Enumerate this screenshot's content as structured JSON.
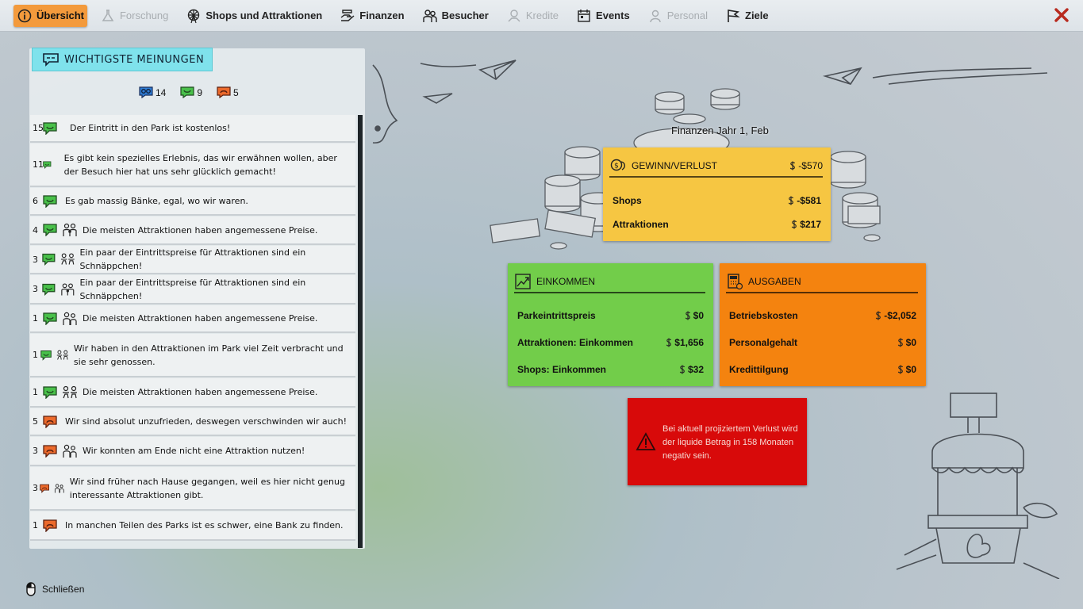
{
  "nav": {
    "tabs": [
      {
        "label": "Übersicht",
        "icon": "info-icon",
        "state": "active"
      },
      {
        "label": "Forschung",
        "icon": "flask-icon",
        "state": "disabled"
      },
      {
        "label": "Shops und Attraktionen",
        "icon": "ferris-wheel-icon",
        "state": "normal"
      },
      {
        "label": "Finanzen",
        "icon": "money-hand-icon",
        "state": "normal"
      },
      {
        "label": "Besucher",
        "icon": "visitors-icon",
        "state": "normal"
      },
      {
        "label": "Kredite",
        "icon": "loan-icon",
        "state": "disabled"
      },
      {
        "label": "Events",
        "icon": "calendar-icon",
        "state": "normal"
      },
      {
        "label": "Personal",
        "icon": "staff-icon",
        "state": "disabled"
      },
      {
        "label": "Ziele",
        "icon": "flag-icon",
        "state": "normal"
      }
    ]
  },
  "opinions": {
    "title": "WICHTIGSTE MEINUNGEN",
    "counts": {
      "neutral": "14",
      "positive": "9",
      "negative": "5"
    },
    "rows": [
      {
        "count": "15",
        "sentiment": "positive",
        "group": "",
        "text": "Der Eintritt in den Park ist kostenlos!"
      },
      {
        "count": "11",
        "sentiment": "positive",
        "group": "",
        "text": "Es gibt kein spezielles Erlebnis, das wir erwähnen wollen, aber der Besuch hier hat uns sehr glücklich gemacht!"
      },
      {
        "count": "6",
        "sentiment": "positive",
        "group": "",
        "text": "Es gab massig Bänke, egal, wo wir waren."
      },
      {
        "count": "4",
        "sentiment": "positive",
        "group": "family",
        "text": "Die meisten Attraktionen haben angemessene Preise."
      },
      {
        "count": "3",
        "sentiment": "positive",
        "group": "teens",
        "text": "Ein paar der Eintrittspreise für Attraktionen sind ein Schnäppchen!"
      },
      {
        "count": "3",
        "sentiment": "positive",
        "group": "family",
        "text": "Ein paar der Eintrittspreise für Attraktionen sind ein Schnäppchen!"
      },
      {
        "count": "1",
        "sentiment": "positive",
        "group": "adults",
        "text": "Die meisten Attraktionen haben angemessene Preise."
      },
      {
        "count": "1",
        "sentiment": "positive",
        "group": "teens",
        "text": "Wir haben in den Attraktionen im Park viel Zeit verbracht und sie sehr genossen."
      },
      {
        "count": "1",
        "sentiment": "positive",
        "group": "teens",
        "text": "Die meisten Attraktionen haben angemessene Preise."
      },
      {
        "count": "5",
        "sentiment": "negative",
        "group": "",
        "text": "Wir sind absolut unzufrieden, deswegen verschwinden wir auch!"
      },
      {
        "count": "3",
        "sentiment": "negative",
        "group": "adults",
        "text": "Wir konnten am Ende nicht eine Attraktion nutzen!"
      },
      {
        "count": "3",
        "sentiment": "negative",
        "group": "adults",
        "text": "Wir sind früher nach Hause gegangen, weil es hier nicht genug interessante Attraktionen gibt."
      },
      {
        "count": "1",
        "sentiment": "negative",
        "group": "",
        "text": "In manchen Teilen des Parks ist es schwer, eine Bank zu finden."
      }
    ]
  },
  "finance": {
    "title": "Finanzen Jahr 1, Feb",
    "profit": {
      "title": "GEWINN/VERLUST",
      "total": "-$570",
      "lines": [
        {
          "label": "Shops",
          "value": "-$581"
        },
        {
          "label": "Attraktionen",
          "value": "$217"
        }
      ]
    },
    "income": {
      "title": "EINKOMMEN",
      "lines": [
        {
          "label": "Parkeintrittspreis",
          "value": "$0"
        },
        {
          "label": "Attraktionen: Einkommen",
          "value": "$1,656"
        },
        {
          "label": "Shops: Einkommen",
          "value": "$32"
        }
      ]
    },
    "expenses": {
      "title": "AUSGABEN",
      "lines": [
        {
          "label": "Betriebskosten",
          "value": "-$2,052"
        },
        {
          "label": "Personalgehalt",
          "value": "$0"
        },
        {
          "label": "Kredittilgung",
          "value": "$0"
        }
      ]
    },
    "warning": "Bei aktuell projiziertem Verlust wird der liquide Betrag in 158 Monaten negativ sein."
  },
  "footer": {
    "close_label": "Schließen"
  },
  "colors": {
    "yellow": "#f6c642",
    "green": "#72cd4a",
    "orange": "#f4830f",
    "red": "#d80a0a",
    "cyan": "#7fe2ec",
    "active_tab": "#f39a3c"
  }
}
